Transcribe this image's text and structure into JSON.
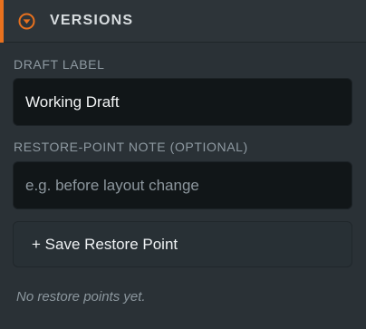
{
  "section": {
    "title": "VERSIONS",
    "toggle_icon": "chevron-down-circle-icon",
    "accent_color": "#e8711e"
  },
  "draft_label": {
    "label": "DRAFT LABEL",
    "value": "Working Draft"
  },
  "restore_note": {
    "label": "RESTORE-POINT NOTE (OPTIONAL)",
    "placeholder": "e.g. before layout change",
    "value": ""
  },
  "save_button": {
    "label": "+ Save Restore Point"
  },
  "restore_points": {
    "items": [],
    "empty_text": "No restore points yet."
  }
}
